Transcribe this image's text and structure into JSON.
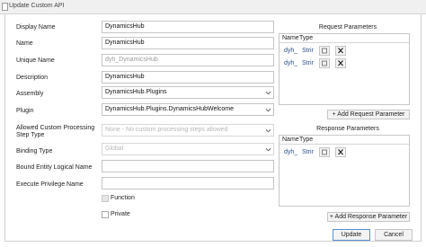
{
  "window": {
    "title": "Update Custom API"
  },
  "form": {
    "display_name": {
      "label": "Display Name",
      "value": "DynamicsHub"
    },
    "name": {
      "label": "Name",
      "value": "DynamicsHub"
    },
    "unique_name": {
      "label": "Unique Name",
      "value": "dyh_DynamicsHub"
    },
    "description": {
      "label": "Description",
      "value": "DynamicsHub"
    },
    "assembly": {
      "label": "Assembly",
      "value": "DynamicsHub.Plugins"
    },
    "plugin": {
      "label": "Plugin",
      "value": "DynamicsHub.Plugins.DynamicsHubWelcome"
    },
    "allowed_step_type": {
      "label_line1": "Allowed Custom Processing",
      "label_line2": "Step Type",
      "value": "None - No custom processing steps allowed"
    },
    "binding_type": {
      "label": "Binding Type",
      "value": "Global"
    },
    "bound_entity": {
      "label": "Bound Entity Logical Name",
      "value": ""
    },
    "execute_privilege": {
      "label": "Execute Privilege Name",
      "value": ""
    },
    "function": {
      "label": "Function",
      "checked": false
    },
    "private": {
      "label": "Private",
      "checked": false
    }
  },
  "request_parameters": {
    "title": "Request Parameters",
    "col_name": "Name",
    "col_type": "Type",
    "rows": [
      {
        "name": "dyh_",
        "type": "Strir"
      },
      {
        "name": "dyh_",
        "type": "Strir"
      }
    ],
    "add_label": "+ Add Request Parameter"
  },
  "response_parameters": {
    "title": "Response Parameters",
    "col_name": "Name",
    "col_type": "Type",
    "rows": [
      {
        "name": "dyh_",
        "type": "Strir"
      }
    ],
    "add_label": "+ Add Response Parameter"
  },
  "footer": {
    "update_label": "Update",
    "cancel_label": "Cancel"
  },
  "colors": {
    "accent": "#5b8fd1",
    "link_text": "#2a4f8a",
    "border": "#c6c6c6"
  }
}
